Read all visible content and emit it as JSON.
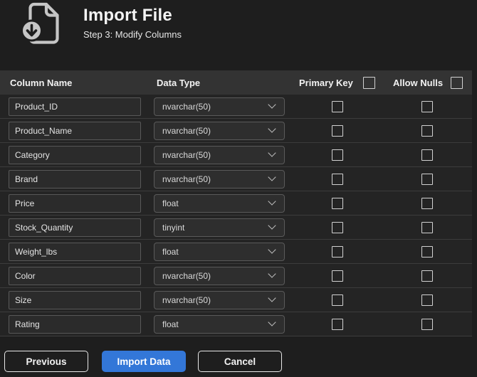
{
  "header": {
    "title": "Import File",
    "subtitle": "Step 3: Modify Columns",
    "icon": "file-download-icon"
  },
  "table": {
    "columns": {
      "name": "Column Name",
      "type": "Data Type",
      "primary_key": "Primary Key",
      "allow_nulls": "Allow Nulls"
    },
    "select_all": {
      "primary_key_checked": false,
      "allow_nulls_checked": false
    },
    "rows": [
      {
        "name": "Product_ID",
        "type": "nvarchar(50)",
        "primary_key": false,
        "allow_nulls": false
      },
      {
        "name": "Product_Name",
        "type": "nvarchar(50)",
        "primary_key": false,
        "allow_nulls": false
      },
      {
        "name": "Category",
        "type": "nvarchar(50)",
        "primary_key": false,
        "allow_nulls": false
      },
      {
        "name": "Brand",
        "type": "nvarchar(50)",
        "primary_key": false,
        "allow_nulls": false
      },
      {
        "name": "Price",
        "type": "float",
        "primary_key": false,
        "allow_nulls": false
      },
      {
        "name": "Stock_Quantity",
        "type": "tinyint",
        "primary_key": false,
        "allow_nulls": false
      },
      {
        "name": "Weight_lbs",
        "type": "float",
        "primary_key": false,
        "allow_nulls": false
      },
      {
        "name": "Color",
        "type": "nvarchar(50)",
        "primary_key": false,
        "allow_nulls": false
      },
      {
        "name": "Size",
        "type": "nvarchar(50)",
        "primary_key": false,
        "allow_nulls": false
      },
      {
        "name": "Rating",
        "type": "float",
        "primary_key": false,
        "allow_nulls": false
      }
    ]
  },
  "footer": {
    "previous_label": "Previous",
    "import_label": "Import Data",
    "cancel_label": "Cancel"
  },
  "colors": {
    "accent_blue": "#3377D8",
    "page_bg": "#1E1E1E",
    "table_header_bg": "#333333",
    "row_bg": "#242424",
    "icon_gray": "#C6C6C6"
  }
}
